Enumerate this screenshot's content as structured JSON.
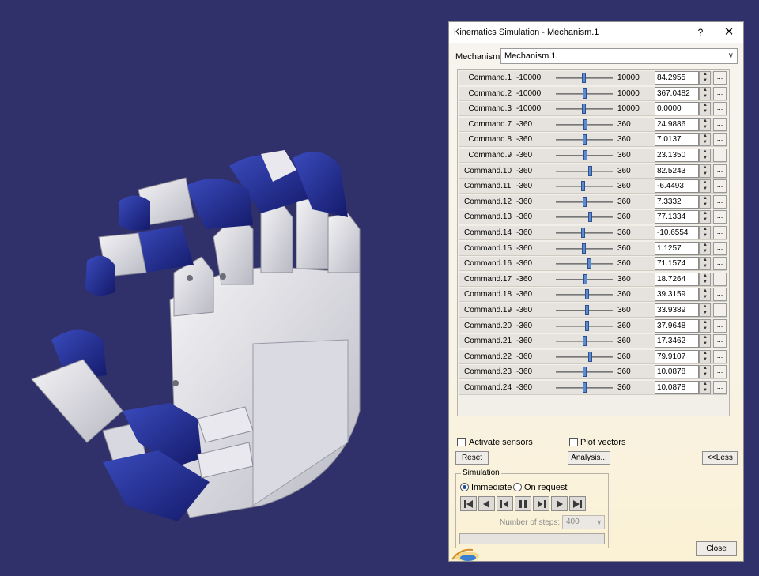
{
  "viewport": {
    "background": "#30306a",
    "accent_blue": "#1e2a8c",
    "part_white": "#e4e4e8"
  },
  "dialog": {
    "title": "Kinematics Simulation - Mechanism.1",
    "help": "?",
    "close_glyph": "✕",
    "mechanism_label": "Mechanism:",
    "mechanism_value": "Mechanism.1",
    "commands": [
      {
        "name": "Command.1",
        "min": "-10000",
        "max": "10000",
        "value": "84.2955",
        "level": 0.5
      },
      {
        "name": "Command.2",
        "min": "-10000",
        "max": "10000",
        "value": "367.0482",
        "level": 0.52
      },
      {
        "name": "Command.3",
        "min": "-10000",
        "max": "10000",
        "value": "0.0000",
        "level": 0.5
      },
      {
        "name": "Command.7",
        "min": "-360",
        "max": "360",
        "value": "24.9886",
        "level": 0.53
      },
      {
        "name": "Command.8",
        "min": "-360",
        "max": "360",
        "value": "7.0137",
        "level": 0.51
      },
      {
        "name": "Command.9",
        "min": "-360",
        "max": "360",
        "value": "23.1350",
        "level": 0.53
      },
      {
        "name": "Command.10",
        "min": "-360",
        "max": "360",
        "value": "82.5243",
        "level": 0.61
      },
      {
        "name": "Command.11",
        "min": "-360",
        "max": "360",
        "value": "-6.4493",
        "level": 0.49
      },
      {
        "name": "Command.12",
        "min": "-360",
        "max": "360",
        "value": "7.3332",
        "level": 0.51
      },
      {
        "name": "Command.13",
        "min": "-360",
        "max": "360",
        "value": "77.1334",
        "level": 0.61
      },
      {
        "name": "Command.14",
        "min": "-360",
        "max": "360",
        "value": "-10.6554",
        "level": 0.49
      },
      {
        "name": "Command.15",
        "min": "-360",
        "max": "360",
        "value": "1.1257",
        "level": 0.5
      },
      {
        "name": "Command.16",
        "min": "-360",
        "max": "360",
        "value": "71.1574",
        "level": 0.6
      },
      {
        "name": "Command.17",
        "min": "-360",
        "max": "360",
        "value": "18.7264",
        "level": 0.53
      },
      {
        "name": "Command.18",
        "min": "-360",
        "max": "360",
        "value": "39.3159",
        "level": 0.55
      },
      {
        "name": "Command.19",
        "min": "-360",
        "max": "360",
        "value": "33.9389",
        "level": 0.55
      },
      {
        "name": "Command.20",
        "min": "-360",
        "max": "360",
        "value": "37.9648",
        "level": 0.55
      },
      {
        "name": "Command.21",
        "min": "-360",
        "max": "360",
        "value": "17.3462",
        "level": 0.52
      },
      {
        "name": "Command.22",
        "min": "-360",
        "max": "360",
        "value": "79.9107",
        "level": 0.61
      },
      {
        "name": "Command.23",
        "min": "-360",
        "max": "360",
        "value": "10.0878",
        "level": 0.51
      },
      {
        "name": "Command.24",
        "min": "-360",
        "max": "360",
        "value": "10.0878",
        "level": 0.51
      }
    ],
    "more_label": "...",
    "activate_sensors": "Activate sensors",
    "plot_vectors": "Plot vectors",
    "reset": "Reset",
    "analysis": "Analysis...",
    "less": "<<Less",
    "simulation": {
      "legend": "Simulation",
      "immediate": "Immediate",
      "on_request": "On request",
      "steps_label": "Number of steps:",
      "steps_value": "400"
    },
    "close_button": "Close"
  }
}
